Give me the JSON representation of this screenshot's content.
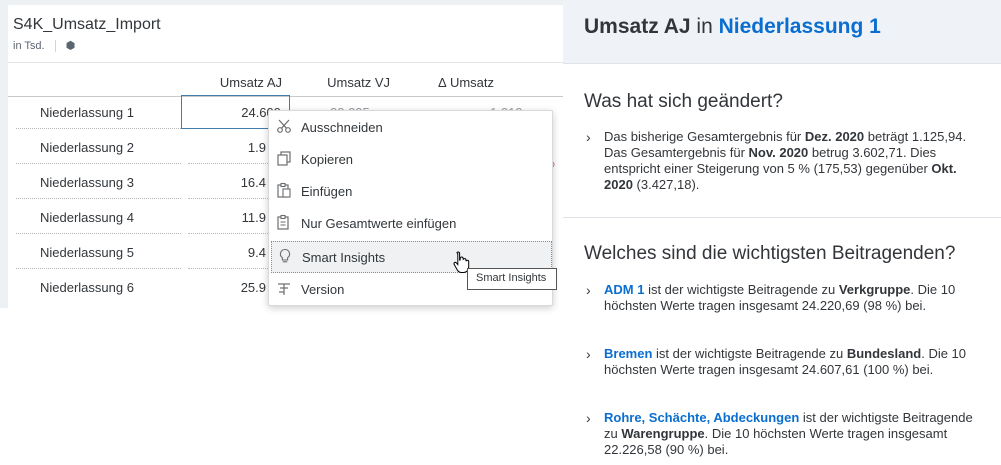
{
  "widget": {
    "title": "S4K_Umsatz_Import",
    "subtitle": "in Tsd.",
    "columns": [
      "Umsatz AJ",
      "Umsatz VJ",
      "∆ Umsatz"
    ],
    "rows": [
      {
        "label": "Niederlassung 1",
        "value": "24.609"
      },
      {
        "label": "Niederlassung 2",
        "value": "1.9"
      },
      {
        "label": "Niederlassung 3",
        "value": "16.4"
      },
      {
        "label": "Niederlassung 4",
        "value": "11.9"
      },
      {
        "label": "Niederlassung 5",
        "value": "9.4"
      },
      {
        "label": "Niederlassung 6",
        "value": "25.9"
      }
    ],
    "row1_vj_partial": "23.235",
    "row1_delta_partial": "1.212",
    "row2_delta_red_fragment": "2 %"
  },
  "menu": {
    "items": [
      {
        "label": "Ausschneiden",
        "icon": "scissors-icon"
      },
      {
        "label": "Kopieren",
        "icon": "copy-icon"
      },
      {
        "label": "Einfügen",
        "icon": "paste-icon"
      },
      {
        "label": "Nur Gesamtwerte einfügen",
        "icon": "paste-values-icon"
      },
      {
        "label": "Smart Insights",
        "icon": "lightbulb-icon"
      },
      {
        "label": "Version",
        "icon": "version-icon"
      }
    ],
    "tooltip": "Smart Insights"
  },
  "panel": {
    "title_prefix": "Umsatz AJ",
    "title_mid": " in ",
    "title_highlight": "Niederlassung 1",
    "section1_title": "Was hat sich geändert?",
    "section2_title": "Welches sind die wichtigsten Beitragenden?",
    "change": {
      "t1": "Das bisherige Gesamtergebnis für ",
      "b1": "Dez. 2020",
      "t2": " beträgt 1.125,94. Das Gesamtergebnis für ",
      "b2": "Nov. 2020",
      "t3": " betrug 3.602,71. Dies entspricht einer Steigerung von 5 % (175,53) gegenüber ",
      "b3": "Okt. 2020",
      "t4": " (3.427,18)."
    },
    "contributors": [
      {
        "link": "ADM 1",
        "t1": " ist der wichtigste Beitragende zu ",
        "bold": "Verkgruppe",
        "t2": ". Die 10 höchsten Werte tragen insgesamt 24.220,69 (98 %) bei."
      },
      {
        "link": "Bremen",
        "t1": " ist der wichtigste Beitragende zu ",
        "bold": "Bundesland",
        "t2": ". Die 10 höchsten Werte tragen insgesamt 24.607,61 (100 %) bei."
      },
      {
        "link": "Rohre, Schächte, Abdeckungen",
        "t1": " ist der wichtigste Beitragende zu ",
        "bold": "Warengruppe",
        "t2": ". Die 10 höchsten Werte tragen insgesamt 22.226,58 (90 %) bei."
      }
    ]
  }
}
